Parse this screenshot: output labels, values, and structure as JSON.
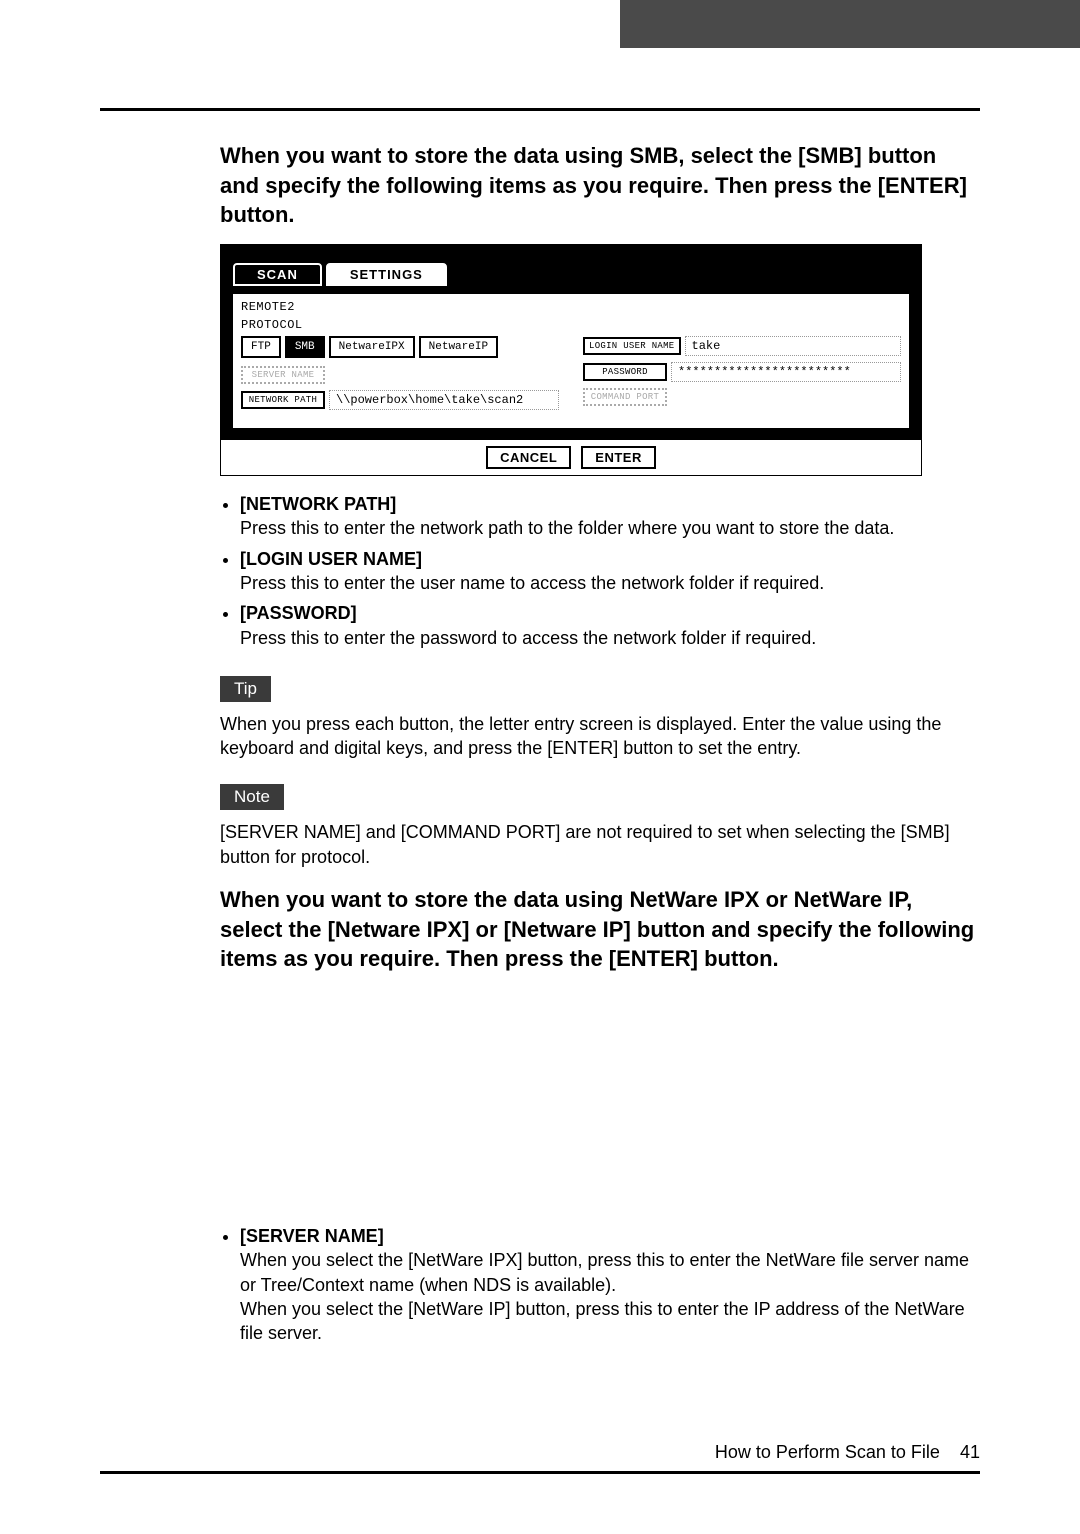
{
  "heading1": "When you want to store the data using SMB, select the [SMB] button and specify the following items as you require. Then press the [ENTER] button.",
  "panel": {
    "tabs": {
      "scan": "SCAN",
      "settings": "SETTINGS"
    },
    "remote_label": "REMOTE2",
    "protocol_label": "PROTOCOL",
    "protocols": {
      "ftp": "FTP",
      "smb": "SMB",
      "ipx": "NetwareIPX",
      "ip": "NetwareIP"
    },
    "server_name_btn": "SERVER NAME",
    "network_path_btn": "NETWORK PATH",
    "network_path_val": "\\\\powerbox\\home\\take\\scan2",
    "login_btn": "LOGIN USER NAME",
    "login_val": "take",
    "password_btn": "PASSWORD",
    "password_val": "************************",
    "cmdport_btn": "COMMAND PORT",
    "cancel": "CANCEL",
    "enter": "ENTER"
  },
  "bullets1": [
    {
      "head": "[NETWORK PATH]",
      "desc": "Press this to enter the network path to the folder where you want to store the data."
    },
    {
      "head": "[LOGIN USER NAME]",
      "desc": "Press this to enter the user name to access the network folder if required."
    },
    {
      "head": "[PASSWORD]",
      "desc": "Press this to enter the password to access the network folder if required."
    }
  ],
  "tip_label": "Tip",
  "tip_text": "When you press each button, the letter entry screen is displayed. Enter the value using the keyboard and digital keys, and press the [ENTER] button to set the entry.",
  "note_label": "Note",
  "note_text": "[SERVER NAME] and [COMMAND PORT] are not required to set when selecting the [SMB] button for protocol.",
  "heading2": "When you want to store the data using NetWare IPX or NetWare IP, select the [Netware IPX] or [Netware IP] button and specify the following items as you require. Then press the [ENTER] button.",
  "bullets2": [
    {
      "head": "[SERVER NAME]",
      "desc": "When you select the [NetWare IPX] button, press this to enter the NetWare file server name or Tree/Context name (when NDS is available).\nWhen you select the [NetWare IP] button, press this to enter the IP address of the NetWare file server."
    }
  ],
  "footer": {
    "title": "How to Perform Scan to File",
    "page": "41"
  }
}
